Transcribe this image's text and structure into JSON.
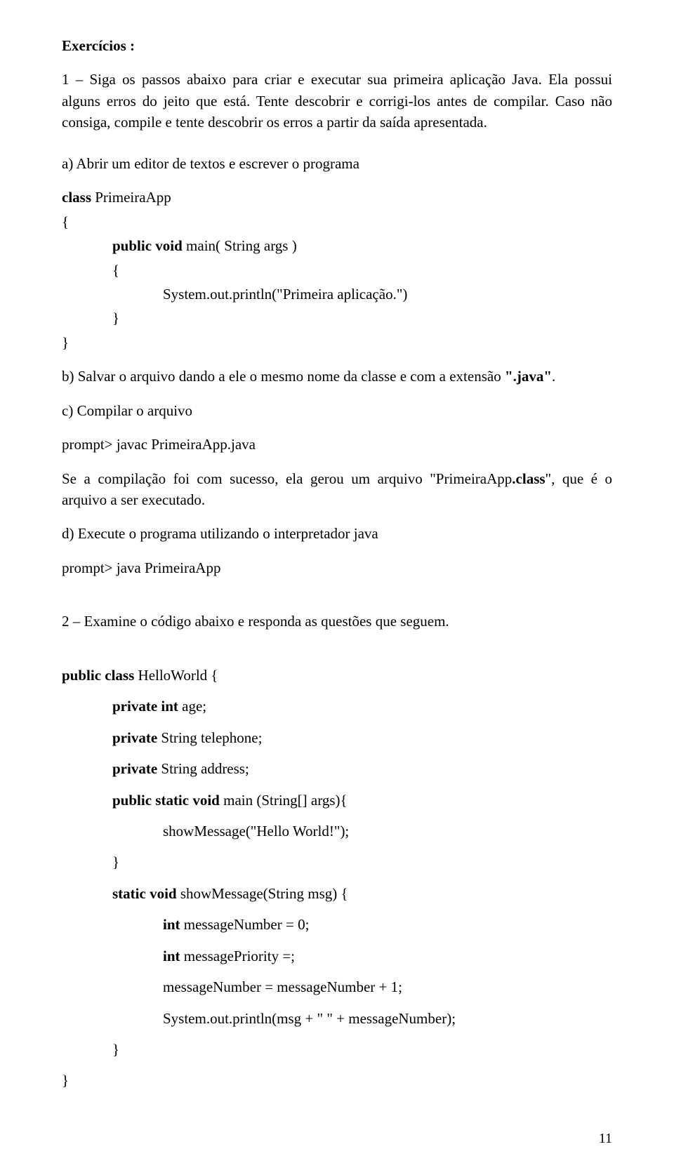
{
  "h_title": "Exercícios :",
  "ex1_line": "1 – Siga os passos abaixo para criar e executar sua primeira aplicação Java. Ela possui alguns erros do jeito que está. Tente descobrir e corrigi-los antes de compilar. Caso não consiga, compile e tente descobrir os erros a partir da saída apresentada.",
  "a_line": "a) Abrir um editor de textos e escrever o programa",
  "code1_l1a": "class ",
  "code1_l1b": "PrimeiraApp",
  "code1_l2": "{",
  "code1_l3a": "public void ",
  "code1_l3b": "main( String  args )",
  "code1_l4": "{",
  "code1_l5": "System.out.println(\"Primeira aplicação.\")",
  "code1_l6": "}",
  "code1_l7": "}",
  "b_line_a": "b) Salvar o arquivo dando a ele o mesmo nome da classe e com a extensão ",
  "b_line_b": "\".java\"",
  "b_line_c": ".",
  "c_line": "c) Compilar o arquivo",
  "c_cmd": "prompt> javac PrimeiraApp.java",
  "c_after_a": "Se a compilação foi com sucesso, ela gerou um arquivo \"PrimeiraApp",
  "c_after_b": ".class",
  "c_after_c": "\", que é o arquivo a ser executado.",
  "d_line": "d) Execute o programa utilizando o interpretador java",
  "d_cmd": "prompt> java PrimeiraApp",
  "ex2_line": "2 – Examine o código abaixo e responda as questões que seguem.",
  "code2_l1a": "public class ",
  "code2_l1b": "HelloWorld {",
  "code2_l2a": "private int ",
  "code2_l2b": "age;",
  "code2_l3a": "private ",
  "code2_l3b": "String telephone;",
  "code2_l4a": "private ",
  "code2_l4b": "String address;",
  "code2_l5a": "public static void ",
  "code2_l5b": "main (String[] args){",
  "code2_l6": "showMessage(\"Hello World!\");",
  "code2_l7": "}",
  "code2_l8a": "static void ",
  "code2_l8b": "showMessage(String msg) {",
  "code2_l9a": "int ",
  "code2_l9b": "messageNumber = 0;",
  "code2_l10a": "int ",
  "code2_l10b": "messagePriority =;",
  "code2_l11": "messageNumber = messageNumber + 1;",
  "code2_l12": "System.out.println(msg + \" \" + messageNumber);",
  "code2_l13": "}",
  "code2_l14": "}",
  "page_number": "11"
}
